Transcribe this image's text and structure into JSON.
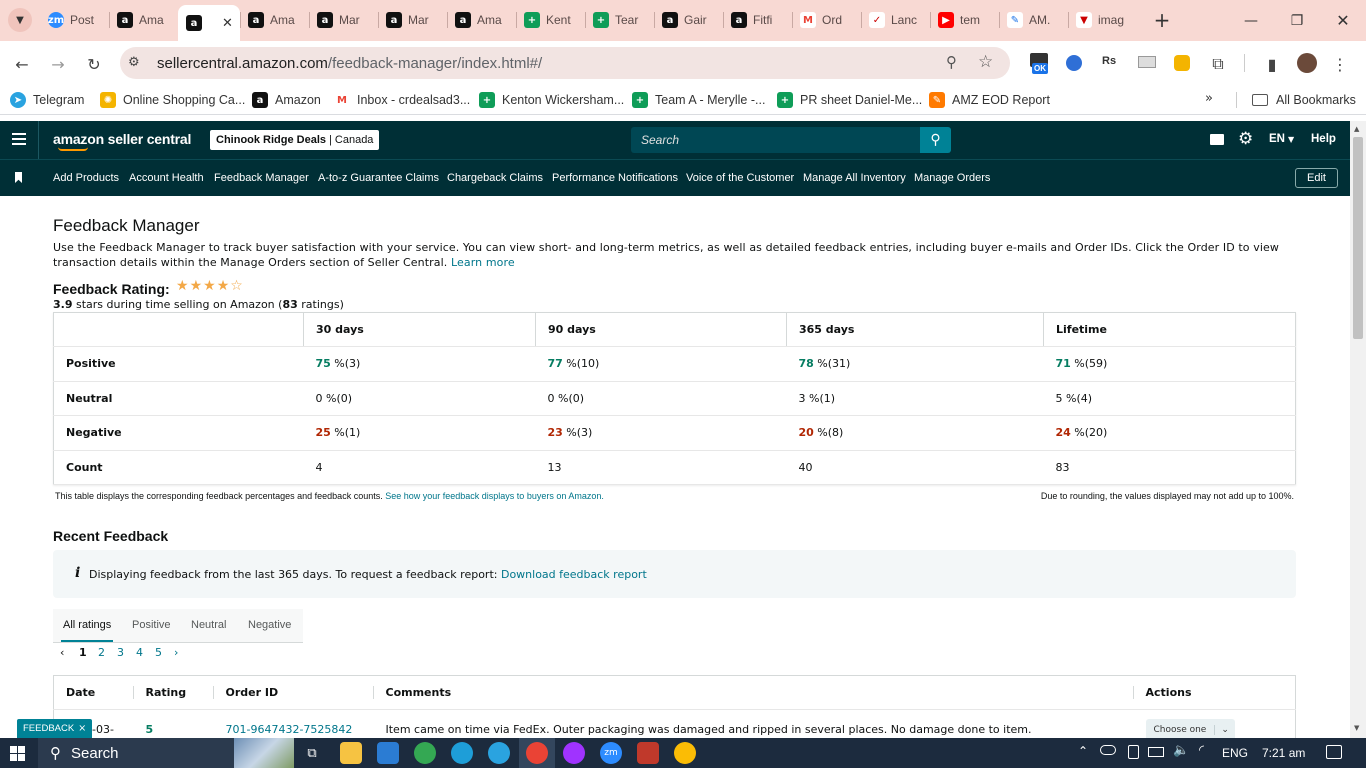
{
  "browser": {
    "tabs": [
      {
        "label": "Post",
        "favicon": "zm"
      },
      {
        "label": "Ama",
        "favicon": "a"
      },
      {
        "label": "",
        "favicon": "a",
        "active": true
      },
      {
        "label": "Ama",
        "favicon": "a"
      },
      {
        "label": "Mar",
        "favicon": "a"
      },
      {
        "label": "Mar",
        "favicon": "a"
      },
      {
        "label": "Ama",
        "favicon": "a"
      },
      {
        "label": "Kent",
        "favicon": "+"
      },
      {
        "label": "Tear",
        "favicon": "+"
      },
      {
        "label": "Gair",
        "favicon": "a"
      },
      {
        "label": "Fitfi",
        "favicon": "a"
      },
      {
        "label": "Ord",
        "favicon": "M"
      },
      {
        "label": "Lanc",
        "favicon": "✓"
      },
      {
        "label": "tem",
        "favicon": "▶"
      },
      {
        "label": "AM.",
        "favicon": "✎"
      },
      {
        "label": "imag",
        "favicon": "▼"
      }
    ],
    "url_host": "sellercentral.amazon.com",
    "url_path": "/feedback-manager/index.html#/",
    "ext_badge": "OK",
    "bookmarks": [
      {
        "label": "Telegram",
        "icon": "telegram-icon"
      },
      {
        "label": "Online Shopping Ca...",
        "icon": "sun-icon"
      },
      {
        "label": "Amazon",
        "icon": "amazon-icon"
      },
      {
        "label": "Inbox - crdealsad3...",
        "icon": "gmail-icon"
      },
      {
        "label": "Kenton Wickersham...",
        "icon": "sheets-icon"
      },
      {
        "label": "Team A - Merylle -...",
        "icon": "sheets-icon"
      },
      {
        "label": "PR sheet Daniel-Me...",
        "icon": "sheets-icon"
      },
      {
        "label": "AMZ EOD Report",
        "icon": "pen-icon"
      }
    ],
    "all_bookmarks": "All Bookmarks"
  },
  "header": {
    "logo_text": "amazon seller central",
    "store": "Chinook Ridge Deals",
    "market": "Canada",
    "search_placeholder": "Search",
    "lang": "EN",
    "help": "Help"
  },
  "nav": {
    "items": [
      "Add Products",
      "Account Health",
      "Feedback Manager",
      "A-to-z Guarantee Claims",
      "Chargeback Claims",
      "Performance Notifications",
      "Voice of the Customer",
      "Manage All Inventory",
      "Manage Orders"
    ],
    "edit": "Edit"
  },
  "main": {
    "title": "Feedback Manager",
    "description": "Use the Feedback Manager to track buyer satisfaction with your service. You can view short- and long-term metrics, as well as detailed feedback entries, including buyer e-mails and Order IDs. Click the Order ID to view transaction details within the Manage Orders section of Seller Central.",
    "learn_more": "Learn more",
    "rating_label": "Feedback Rating:",
    "rating_stars": 3.9,
    "rating_value": "3.9",
    "rating_suffix": "stars during time selling on Amazon (",
    "rating_count": "83",
    "rating_suffix2": "ratings)",
    "table": {
      "headers": [
        "30 days",
        "90 days",
        "365 days",
        "Lifetime"
      ],
      "rows": [
        {
          "label": "Positive",
          "cells": [
            [
              "75",
              " %(3)"
            ],
            [
              "77",
              " %(10)"
            ],
            [
              "78",
              " %(31)"
            ],
            [
              "71",
              " %(59)"
            ]
          ]
        },
        {
          "label": "Neutral",
          "cells": [
            [
              "0",
              " %(0)"
            ],
            [
              "0",
              " %(0)"
            ],
            [
              "3",
              " %(1)"
            ],
            [
              "5",
              " %(4)"
            ]
          ]
        },
        {
          "label": "Negative",
          "cells": [
            [
              "25",
              " %(1)"
            ],
            [
              "23",
              " %(3)"
            ],
            [
              "20",
              " %(8)"
            ],
            [
              "24",
              " %(20)"
            ]
          ]
        },
        {
          "label": "Count",
          "cells": [
            [
              "4",
              ""
            ],
            [
              "13",
              ""
            ],
            [
              "40",
              ""
            ],
            [
              "83",
              ""
            ]
          ]
        }
      ]
    },
    "table_note": "This table displays the corresponding feedback percentages and feedback counts.",
    "table_note_link": "See how your feedback displays to buyers on Amazon.",
    "rounding_note": "Due to rounding, the values displayed may not add up to 100%.",
    "recent_title": "Recent Feedback",
    "info_text": "Displaying feedback from the last 365 days. To request a feedback report:",
    "info_link": "Download feedback report",
    "filter_tabs": [
      "All ratings",
      "Positive",
      "Neutral",
      "Negative"
    ],
    "pages": [
      "1",
      "2",
      "3",
      "4",
      "5"
    ],
    "recent_headers": [
      "Date",
      "Rating",
      "Order ID",
      "Comments",
      "Actions"
    ],
    "recent_rows": [
      {
        "date": "-03-",
        "rating": "5",
        "order": "701-9647432-7525842",
        "comment": "Item came on time via FedEx. Outer packaging was damaged and ripped in several places. No damage done to item.",
        "action": "Choose one"
      }
    ],
    "feedback_tab": "FEEDBACK"
  },
  "taskbar": {
    "search": "Search",
    "lang": "ENG",
    "time": "7:21 am"
  },
  "colors": {
    "header": "#002f36",
    "positive": "#067d62",
    "negative": "#b12704",
    "link": "#00768b"
  }
}
